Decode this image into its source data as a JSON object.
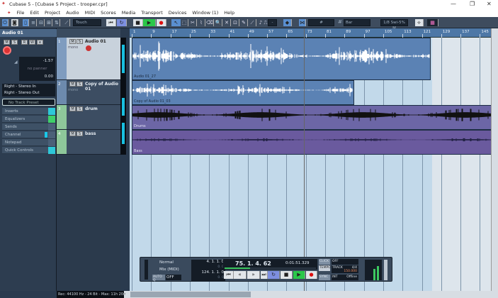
{
  "window": {
    "title": "Cubase 5 - [Cubase 5 Project - trooper.cpr]",
    "minimize": "—",
    "restore": "❐",
    "close": "✕"
  },
  "menu": [
    "File",
    "Edit",
    "Project",
    "Audio",
    "MIDI",
    "Scores",
    "Media",
    "Transport",
    "Devices",
    "Window (1)",
    "Help"
  ],
  "toolbar": {
    "automation_mode": "Touch",
    "grid_type": "Bar",
    "quantize": "1/8 Swi-5% M",
    "nudge": "-"
  },
  "inspector": {
    "track_name": "Audio 01",
    "volume": "-1.57",
    "pan": "no panner",
    "delay": "0.00",
    "input": "Right - Stereo In",
    "output": "Right - Stereo Out",
    "preset": "No Track Preset",
    "sections": [
      "Inserts",
      "Equalizers",
      "Sends",
      "Channel",
      "Notepad",
      "Quick Controls"
    ]
  },
  "tracks": [
    {
      "num": "1",
      "name": "Audio 01",
      "mode": "mono",
      "color": "#5b82b4",
      "event": "Audio 01_27"
    },
    {
      "num": "2",
      "name": "Copy of Audio 01",
      "mode": "mono",
      "color": "#5b82b4",
      "event": "Copy of Audio 01_03"
    },
    {
      "num": "3",
      "name": "drum",
      "color": "#6c66a6",
      "event": "Drums"
    },
    {
      "num": "4",
      "name": "bass",
      "color": "#6a5a9e",
      "event": "Bass"
    }
  ],
  "ruler": [
    "1",
    "9",
    "17",
    "25",
    "33",
    "41",
    "49",
    "57",
    "65",
    "73",
    "81",
    "89",
    "97",
    "105",
    "113",
    "121",
    "129",
    "137",
    "145"
  ],
  "transport": {
    "mode": "Normal",
    "cycle_mode": "Mix (MIDI)",
    "autoq": "AUTO Q",
    "autoq_val": "OFF",
    "left_locator": "4. 1. 1.   0",
    "right_locator": "124. 1. 1.   0",
    "offset1": "0.  0",
    "offset2": "0.  0",
    "position": "75. 1. 4.  62",
    "time": "0:01:51.329",
    "progress": 0.28,
    "click": "CLICK",
    "click_val": "OFF",
    "tempo": "TEMPO",
    "track": "TRACK",
    "signature": "4/4",
    "bpm": "150.000",
    "sync": "SYNC",
    "int": "INT",
    "offline": "Offline"
  },
  "status": "Rec: 44100 Hz - 24 Bit - Max: 11h 20min"
}
